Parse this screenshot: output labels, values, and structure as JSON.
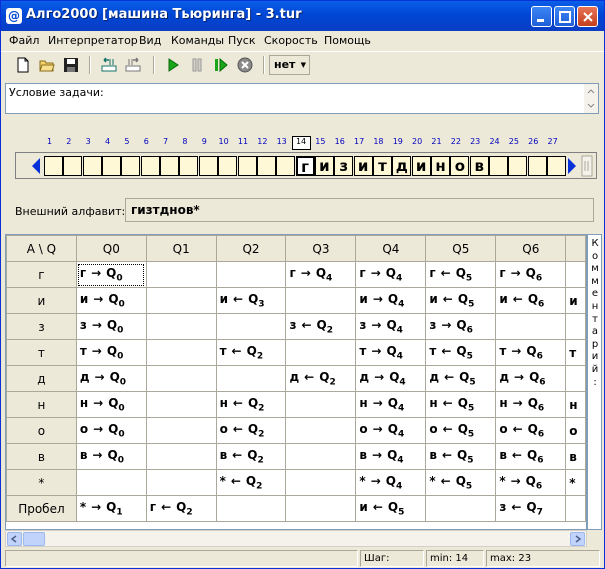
{
  "window": {
    "title": "Алго2000 [машина Тьюринга] - 3.tur",
    "icon_label": "@"
  },
  "menu": [
    {
      "label": "Файл"
    },
    {
      "label": "Интерпретатор"
    },
    {
      "label": "Вид"
    },
    {
      "label": "Команды"
    },
    {
      "label": "Пуск"
    },
    {
      "label": "Скорость"
    },
    {
      "label": "Помощь"
    }
  ],
  "toolbar": {
    "mode_value": "нет"
  },
  "task": {
    "label": "Условие задачи:",
    "value": ""
  },
  "tape": {
    "cell_numbers": [
      "1",
      "2",
      "3",
      "4",
      "5",
      "6",
      "7",
      "8",
      "9",
      "10",
      "11",
      "12",
      "13",
      "14",
      "15",
      "16",
      "17",
      "18",
      "19",
      "20",
      "21",
      "22",
      "23",
      "24",
      "25",
      "26",
      "27"
    ],
    "current_number": "14",
    "cells": [
      "",
      "",
      "",
      "",
      "",
      "",
      "",
      "",
      "",
      "",
      "",
      "",
      "",
      "г",
      "и",
      "з",
      "и",
      "т",
      "д",
      "и",
      "н",
      "о",
      "в",
      "",
      "",
      "",
      ""
    ]
  },
  "alphabet": {
    "label": "Внешний алфавит:",
    "value": "гизтднов*"
  },
  "table": {
    "corner": "A \\ Q",
    "columns": [
      "Q0",
      "Q1",
      "Q2",
      "Q3",
      "Q4",
      "Q5",
      "Q6"
    ],
    "rows": [
      {
        "symbol": "г",
        "cells": [
          [
            "г",
            "→",
            "0"
          ],
          null,
          null,
          [
            "г",
            "→",
            "4"
          ],
          [
            "г",
            "→",
            "4"
          ],
          [
            "г",
            "←",
            "5"
          ],
          [
            "г",
            "→",
            "6"
          ]
        ],
        "overflow": ""
      },
      {
        "symbol": "и",
        "cells": [
          [
            "и",
            "→",
            "0"
          ],
          null,
          [
            "и",
            "←",
            "3"
          ],
          null,
          [
            "и",
            "→",
            "4"
          ],
          [
            "и",
            "←",
            "5"
          ],
          [
            "и",
            "←",
            "6"
          ]
        ],
        "overflow": "и"
      },
      {
        "symbol": "з",
        "cells": [
          [
            "з",
            "→",
            "0"
          ],
          null,
          null,
          [
            "з",
            "←",
            "2"
          ],
          [
            "з",
            "→",
            "4"
          ],
          [
            "з",
            "→",
            "6"
          ],
          null
        ],
        "overflow": ""
      },
      {
        "symbol": "т",
        "cells": [
          [
            "т",
            "→",
            "0"
          ],
          null,
          [
            "т",
            "←",
            "2"
          ],
          null,
          [
            "т",
            "→",
            "4"
          ],
          [
            "т",
            "←",
            "5"
          ],
          [
            "т",
            "→",
            "6"
          ]
        ],
        "overflow": "т"
      },
      {
        "symbol": "д",
        "cells": [
          [
            "д",
            "→",
            "0"
          ],
          null,
          null,
          [
            "д",
            "←",
            "2"
          ],
          [
            "д",
            "→",
            "4"
          ],
          [
            "д",
            "←",
            "5"
          ],
          [
            "д",
            "→",
            "6"
          ]
        ],
        "overflow": ""
      },
      {
        "symbol": "н",
        "cells": [
          [
            "н",
            "→",
            "0"
          ],
          null,
          [
            "н",
            "←",
            "2"
          ],
          null,
          [
            "н",
            "→",
            "4"
          ],
          [
            "н",
            "←",
            "5"
          ],
          [
            "н",
            "→",
            "6"
          ]
        ],
        "overflow": "н"
      },
      {
        "symbol": "о",
        "cells": [
          [
            "о",
            "→",
            "0"
          ],
          null,
          [
            "о",
            "←",
            "2"
          ],
          null,
          [
            "о",
            "→",
            "4"
          ],
          [
            "о",
            "←",
            "5"
          ],
          [
            "о",
            "←",
            "6"
          ]
        ],
        "overflow": "о"
      },
      {
        "symbol": "в",
        "cells": [
          [
            "в",
            "→",
            "0"
          ],
          null,
          [
            "в",
            "←",
            "2"
          ],
          null,
          [
            "в",
            "→",
            "4"
          ],
          [
            "в",
            "←",
            "5"
          ],
          [
            "в",
            "←",
            "6"
          ]
        ],
        "overflow": "в"
      },
      {
        "symbol": "*",
        "cells": [
          null,
          null,
          [
            "*",
            "←",
            "2"
          ],
          null,
          [
            "*",
            "→",
            "4"
          ],
          [
            "*",
            "←",
            "5"
          ],
          [
            "*",
            "→",
            "6"
          ]
        ],
        "overflow": "*"
      },
      {
        "symbol": "Пробел",
        "cells": [
          [
            "*",
            "→",
            "1"
          ],
          [
            "г",
            "←",
            "2"
          ],
          null,
          null,
          [
            "и",
            "←",
            "5"
          ],
          null,
          [
            "з",
            "←",
            "7"
          ]
        ],
        "overflow": ""
      }
    ],
    "selected": {
      "row": 0,
      "col": 0
    }
  },
  "comment": {
    "text": "Комментарий:"
  },
  "status": {
    "step_label": "Шаг:",
    "min": "min: 14",
    "max": "max: 23"
  }
}
